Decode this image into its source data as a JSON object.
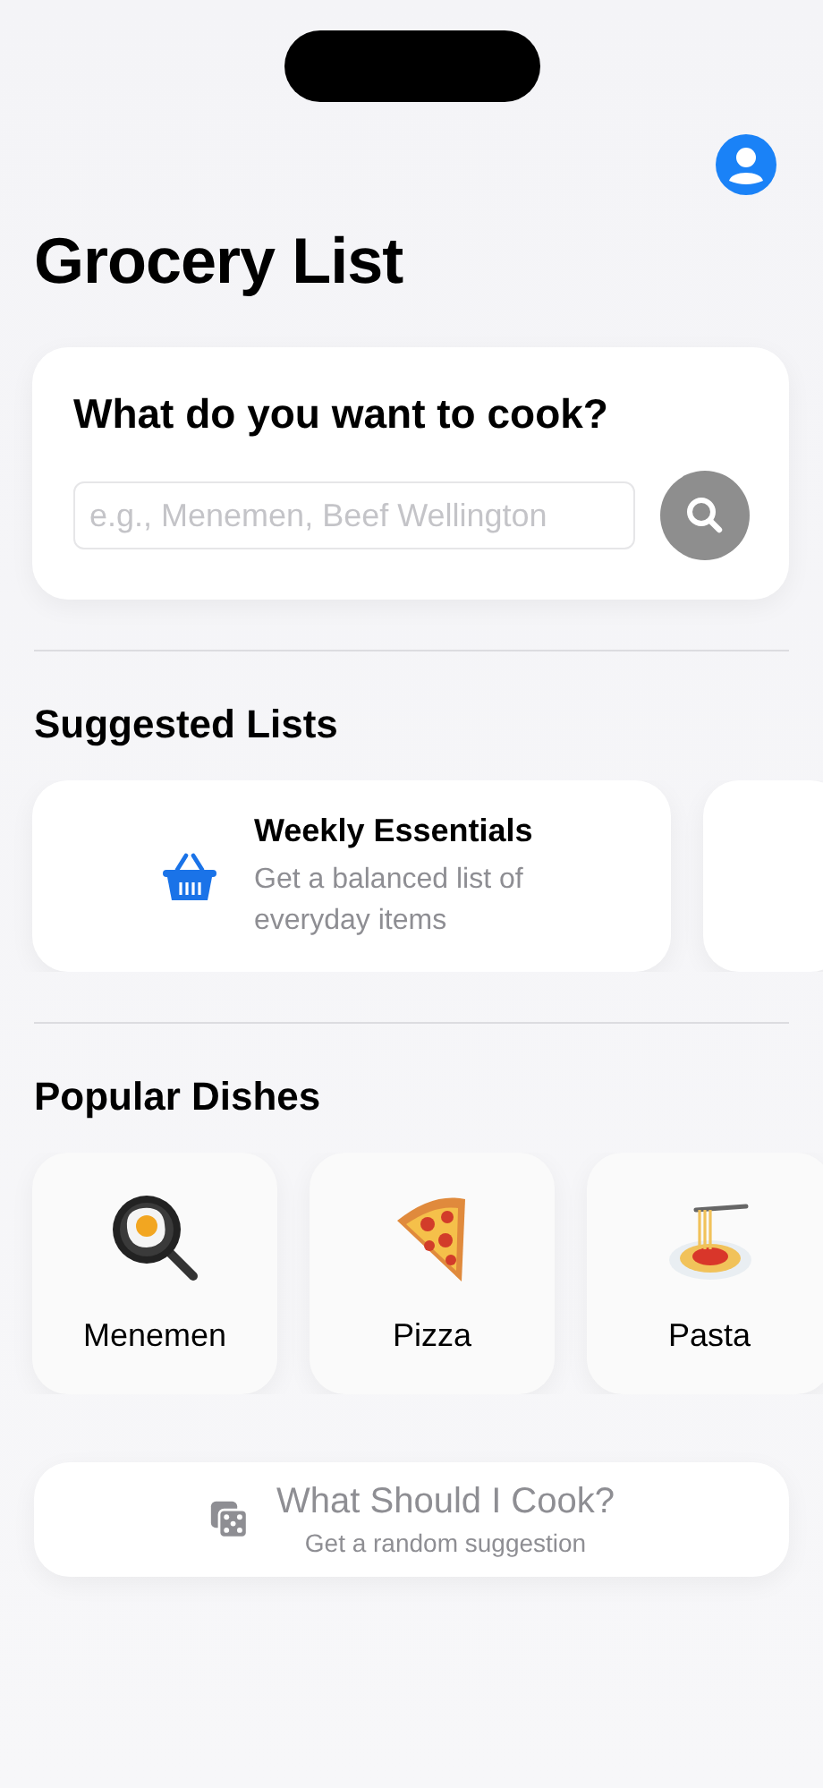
{
  "title": "Grocery List",
  "search_card": {
    "heading": "What do you want to cook?",
    "placeholder": "e.g., Menemen, Beef Wellington"
  },
  "suggested_lists": {
    "heading": "Suggested Lists",
    "items": [
      {
        "kind": "basket",
        "title": "Weekly Essentials",
        "subtitle": "Get a balanced list of everyday items"
      },
      {
        "kind": "blank"
      }
    ]
  },
  "popular_dishes": {
    "heading": "Popular Dishes",
    "items": [
      {
        "kind": "pan",
        "name": "Menemen"
      },
      {
        "kind": "pizza",
        "name": "Pizza"
      },
      {
        "kind": "pasta",
        "name": "Pasta"
      }
    ]
  },
  "random_button": {
    "title": "What Should I Cook?",
    "subtitle": "Get a random suggestion"
  }
}
